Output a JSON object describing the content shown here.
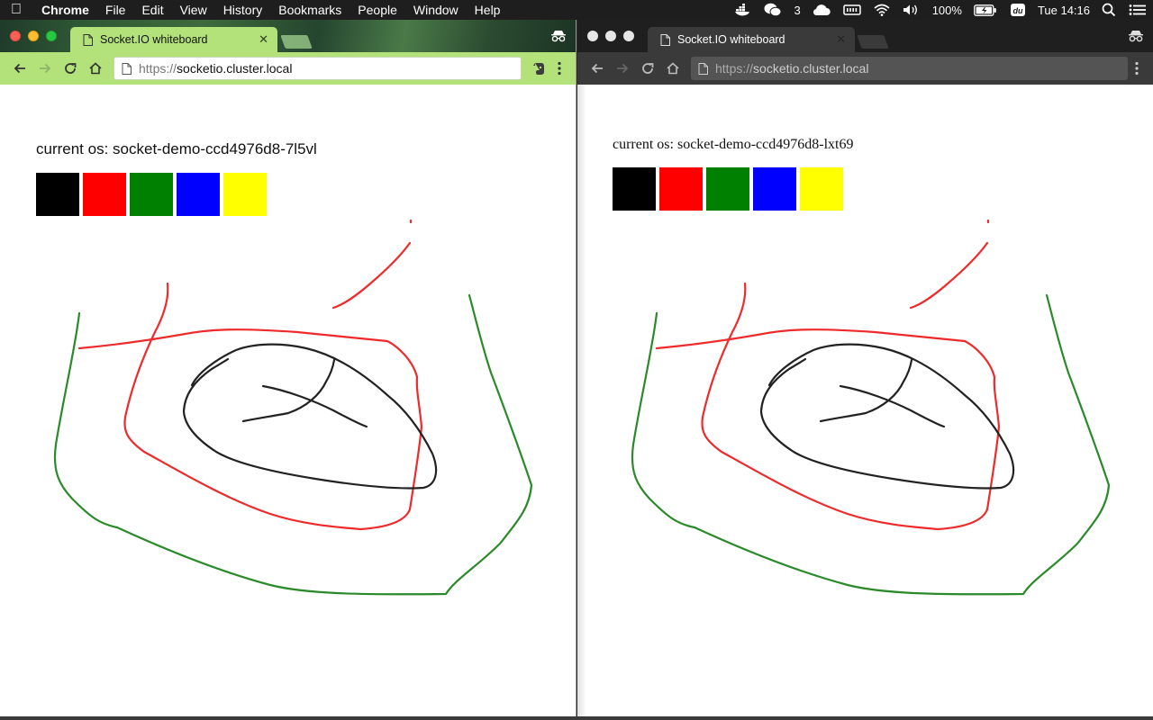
{
  "menubar": {
    "app_name": "Chrome",
    "items": [
      "File",
      "Edit",
      "View",
      "History",
      "Bookmarks",
      "People",
      "Window",
      "Help"
    ],
    "status": {
      "wechat_count": "3",
      "battery": "100%",
      "clock": "Tue 14:16"
    }
  },
  "left_window": {
    "tab_title": "Socket.IO whiteboard",
    "url_scheme": "https://",
    "url_host": "socketio.cluster.local",
    "os_label": "current os: socket-demo-ccd4976d8-7l5vl"
  },
  "right_window": {
    "tab_title": "Socket.IO whiteboard",
    "url_scheme": "https://",
    "url_host": "socketio.cluster.local",
    "os_label": "current os: socket-demo-ccd4976d8-lxt69"
  },
  "colors": {
    "swatches": [
      "#000000",
      "#ff0000",
      "#008000",
      "#0000ff",
      "#ffff00"
    ],
    "stroke_black": "#222222",
    "stroke_red": "#ee2a2a",
    "stroke_green": "#2a8a2a"
  }
}
